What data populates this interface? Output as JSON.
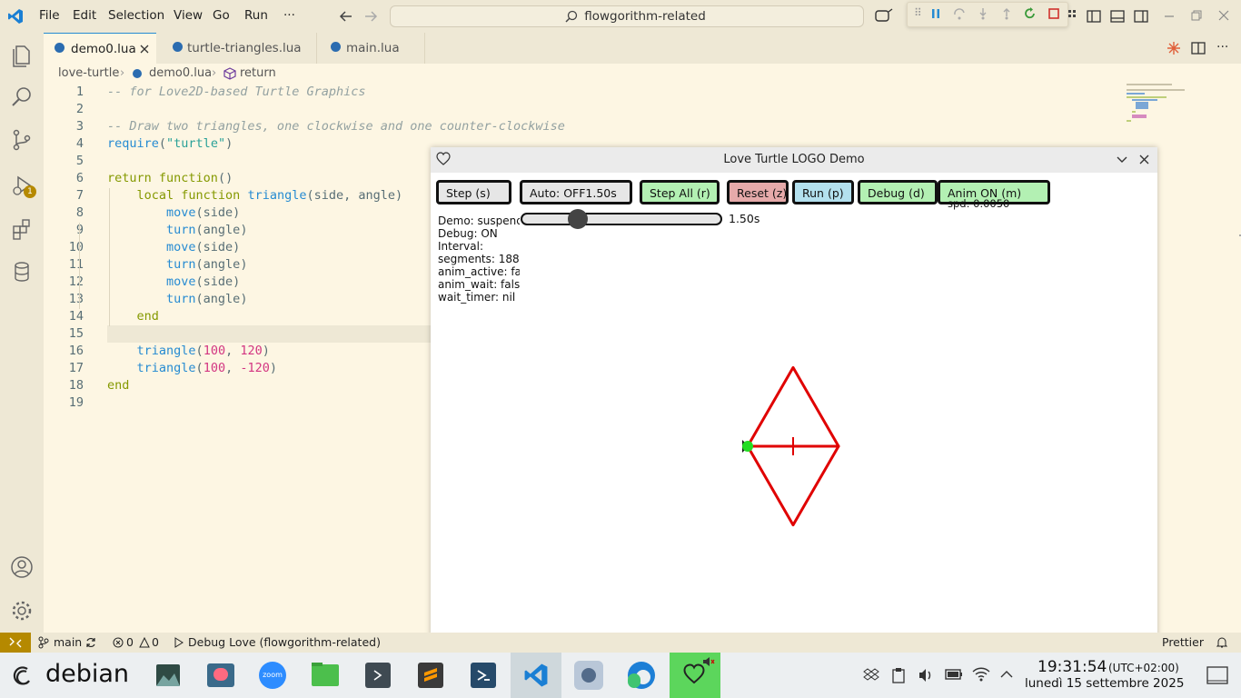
{
  "titlebar": {
    "menu": [
      "File",
      "Edit",
      "Selection",
      "View",
      "Go",
      "Run",
      "···"
    ],
    "command_center": "flowgorithm-related"
  },
  "tabs": [
    {
      "label": "demo0.lua",
      "active": true
    },
    {
      "label": "turtle-triangles.lua",
      "active": false
    },
    {
      "label": "main.lua",
      "active": false
    }
  ],
  "breadcrumb": [
    "love-turtle",
    "demo0.lua",
    "return"
  ],
  "activity": {
    "debug_badge": "1"
  },
  "code_lines": [
    {
      "n": "1",
      "tokens": [
        {
          "t": "-- for Love2D-based Turtle Graphics",
          "c": "c-com"
        }
      ]
    },
    {
      "n": "2",
      "tokens": []
    },
    {
      "n": "3",
      "tokens": [
        {
          "t": "-- Draw two triangles, one clockwise and one counter-clockwise",
          "c": "c-com"
        }
      ]
    },
    {
      "n": "4",
      "tokens": [
        {
          "t": "require",
          "c": "c-fn"
        },
        {
          "t": "(",
          "c": "c-plain"
        },
        {
          "t": "\"turtle\"",
          "c": "c-str"
        },
        {
          "t": ")",
          "c": "c-plain"
        }
      ]
    },
    {
      "n": "5",
      "tokens": []
    },
    {
      "n": "6",
      "tokens": [
        {
          "t": "return ",
          "c": "c-kw"
        },
        {
          "t": "function",
          "c": "c-kw"
        },
        {
          "t": "()",
          "c": "c-plain"
        }
      ]
    },
    {
      "n": "7",
      "tokens": [
        {
          "t": "    local ",
          "c": "c-kw"
        },
        {
          "t": "function ",
          "c": "c-kw"
        },
        {
          "t": "triangle",
          "c": "c-fn"
        },
        {
          "t": "(side, angle)",
          "c": "c-plain"
        }
      ]
    },
    {
      "n": "8",
      "tokens": [
        {
          "t": "        move",
          "c": "c-fn"
        },
        {
          "t": "(side)",
          "c": "c-plain"
        }
      ]
    },
    {
      "n": "9",
      "tokens": [
        {
          "t": "        turn",
          "c": "c-fn"
        },
        {
          "t": "(angle)",
          "c": "c-plain"
        }
      ]
    },
    {
      "n": "10",
      "tokens": [
        {
          "t": "        move",
          "c": "c-fn"
        },
        {
          "t": "(side)",
          "c": "c-plain"
        }
      ]
    },
    {
      "n": "11",
      "tokens": [
        {
          "t": "        turn",
          "c": "c-fn"
        },
        {
          "t": "(angle)",
          "c": "c-plain"
        }
      ]
    },
    {
      "n": "12",
      "tokens": [
        {
          "t": "        move",
          "c": "c-fn"
        },
        {
          "t": "(side)",
          "c": "c-plain"
        }
      ]
    },
    {
      "n": "13",
      "tokens": [
        {
          "t": "        turn",
          "c": "c-fn"
        },
        {
          "t": "(angle)",
          "c": "c-plain"
        }
      ]
    },
    {
      "n": "14",
      "tokens": [
        {
          "t": "    end",
          "c": "c-kw"
        }
      ]
    },
    {
      "n": "15",
      "tokens": []
    },
    {
      "n": "16",
      "tokens": [
        {
          "t": "    triangle",
          "c": "c-fn"
        },
        {
          "t": "(",
          "c": "c-plain"
        },
        {
          "t": "100",
          "c": "c-num"
        },
        {
          "t": ", ",
          "c": "c-plain"
        },
        {
          "t": "120",
          "c": "c-num"
        },
        {
          "t": ")",
          "c": "c-plain"
        }
      ]
    },
    {
      "n": "17",
      "tokens": [
        {
          "t": "    triangle",
          "c": "c-fn"
        },
        {
          "t": "(",
          "c": "c-plain"
        },
        {
          "t": "100",
          "c": "c-num"
        },
        {
          "t": ", ",
          "c": "c-plain"
        },
        {
          "t": "-120",
          "c": "c-num"
        },
        {
          "t": ")",
          "c": "c-plain"
        }
      ]
    },
    {
      "n": "18",
      "tokens": [
        {
          "t": "end",
          "c": "c-kw"
        }
      ]
    },
    {
      "n": "19",
      "tokens": []
    }
  ],
  "love": {
    "title": "Love Turtle LOGO Demo",
    "buttons": [
      {
        "label": "Step (s)",
        "color": "#e6e6e6"
      },
      {
        "label": "Auto: OFF1.50s",
        "color": "#e6e6e6"
      },
      {
        "label": "Step All (r)",
        "color": "#b3f0b3"
      },
      {
        "label": "Reset (z)",
        "color": "#e6aaaa"
      },
      {
        "label": "Run (p)",
        "color": "#b3e0ee"
      },
      {
        "label": "Debug (d)",
        "color": "#b3f0b3"
      },
      {
        "label": "Anim ON (m)",
        "color": "#b3f0b3"
      }
    ],
    "spd": "spd: 0.0050",
    "slider_value_label": "1.50s",
    "slider_position": 0.28,
    "info": [
      "Demo: suspended",
      "Debug: ON",
      "Interval:",
      "segments: 188",
      "anim_active: false",
      "anim_wait: false",
      "wait_timer: nil"
    ],
    "line_color": "#e00000",
    "turtle_color": "#22dd22"
  },
  "statusbar": {
    "branch": "main",
    "problems_errors": "0",
    "problems_warnings": "0",
    "debug_config": "Debug Love (flowgorithm-related)",
    "prettier": "Prettier"
  },
  "taskbar": {
    "start_label": "debian",
    "time": "19:31:54",
    "timezone": "(UTC+02:00)",
    "date": "lunedì 15 settembre 2025"
  },
  "colors": {
    "accent": "#268bd2",
    "background": "#fdf6e3",
    "chrome": "#eee8d5"
  }
}
